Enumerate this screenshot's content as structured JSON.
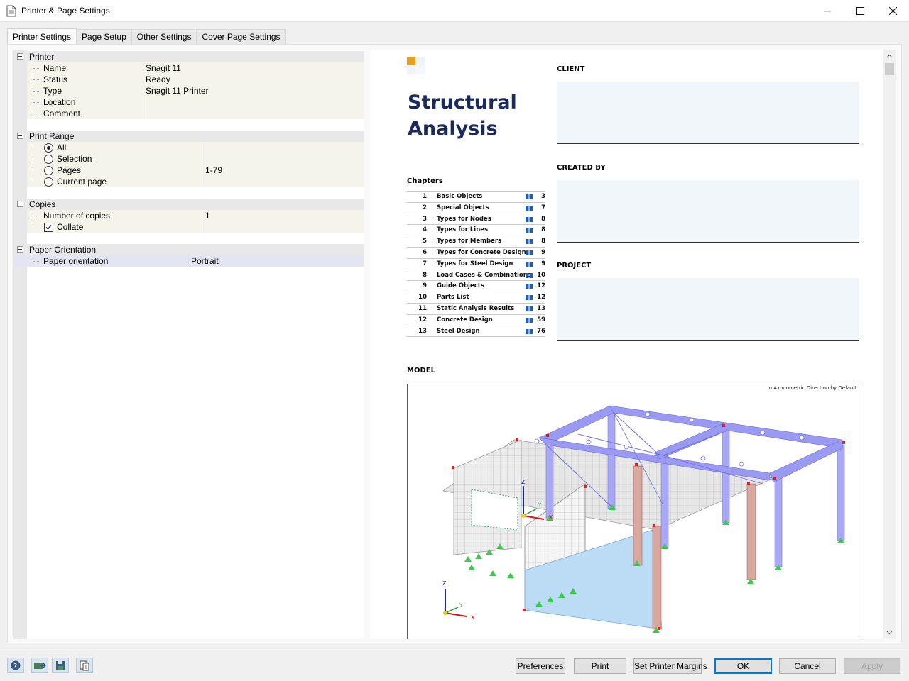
{
  "window": {
    "title": "Printer & Page Settings"
  },
  "tabs": [
    "Printer Settings",
    "Page Setup",
    "Other Settings",
    "Cover Page Settings"
  ],
  "printer": {
    "group": "Printer",
    "rows": [
      {
        "key": "Name",
        "value": "Snagit 11"
      },
      {
        "key": "Status",
        "value": "Ready"
      },
      {
        "key": "Type",
        "value": "Snagit 11 Printer"
      },
      {
        "key": "Location",
        "value": ""
      },
      {
        "key": "Comment",
        "value": ""
      }
    ]
  },
  "print_range": {
    "group": "Print Range",
    "options": [
      {
        "label": "All",
        "selected": true,
        "value": ""
      },
      {
        "label": "Selection",
        "selected": false,
        "value": ""
      },
      {
        "label": "Pages",
        "selected": false,
        "value": "1-79"
      },
      {
        "label": "Current page",
        "selected": false,
        "value": ""
      }
    ]
  },
  "copies": {
    "group": "Copies",
    "number_label": "Number of copies",
    "number_value": "1",
    "collate_label": "Collate",
    "collate_checked": true
  },
  "orientation": {
    "group": "Paper Orientation",
    "label": "Paper orientation",
    "value": "Portrait"
  },
  "preview": {
    "title_line1": "Structural",
    "title_line2": "Analysis",
    "client_label": "CLIENT",
    "created_by_label": "CREATED BY",
    "project_label": "PROJECT",
    "chapters_label": "Chapters",
    "chapters": [
      {
        "num": "1",
        "title": "Basic Objects",
        "page": "3"
      },
      {
        "num": "2",
        "title": "Special Objects",
        "page": "7"
      },
      {
        "num": "3",
        "title": "Types for Nodes",
        "page": "8"
      },
      {
        "num": "4",
        "title": "Types for Lines",
        "page": "8"
      },
      {
        "num": "5",
        "title": "Types for Members",
        "page": "8"
      },
      {
        "num": "6",
        "title": "Types for Concrete Design",
        "page": "9"
      },
      {
        "num": "7",
        "title": "Types for Steel Design",
        "page": "9"
      },
      {
        "num": "8",
        "title": "Load Cases & Combinations",
        "page": "10"
      },
      {
        "num": "9",
        "title": "Guide Objects",
        "page": "12"
      },
      {
        "num": "10",
        "title": "Parts List",
        "page": "12"
      },
      {
        "num": "11",
        "title": "Static Analysis Results",
        "page": "13"
      },
      {
        "num": "12",
        "title": "Concrete Design",
        "page": "59"
      },
      {
        "num": "13",
        "title": "Steel Design",
        "page": "76"
      }
    ],
    "model_label": "MODEL",
    "model_caption": "In Axonometric Direction by Default",
    "axis_labels": {
      "x": "X",
      "y": "Y",
      "z": "Z"
    }
  },
  "buttons": {
    "preferences": "Preferences",
    "print": "Print",
    "set_printer_margins": "Set Printer Margins",
    "ok": "OK",
    "cancel": "Cancel",
    "apply": "Apply"
  },
  "colors": {
    "accent": "#0078d7",
    "title_blue": "#1b2a5c",
    "logo_orange": "#e8a020",
    "member_blue": "#8f8ff0"
  }
}
